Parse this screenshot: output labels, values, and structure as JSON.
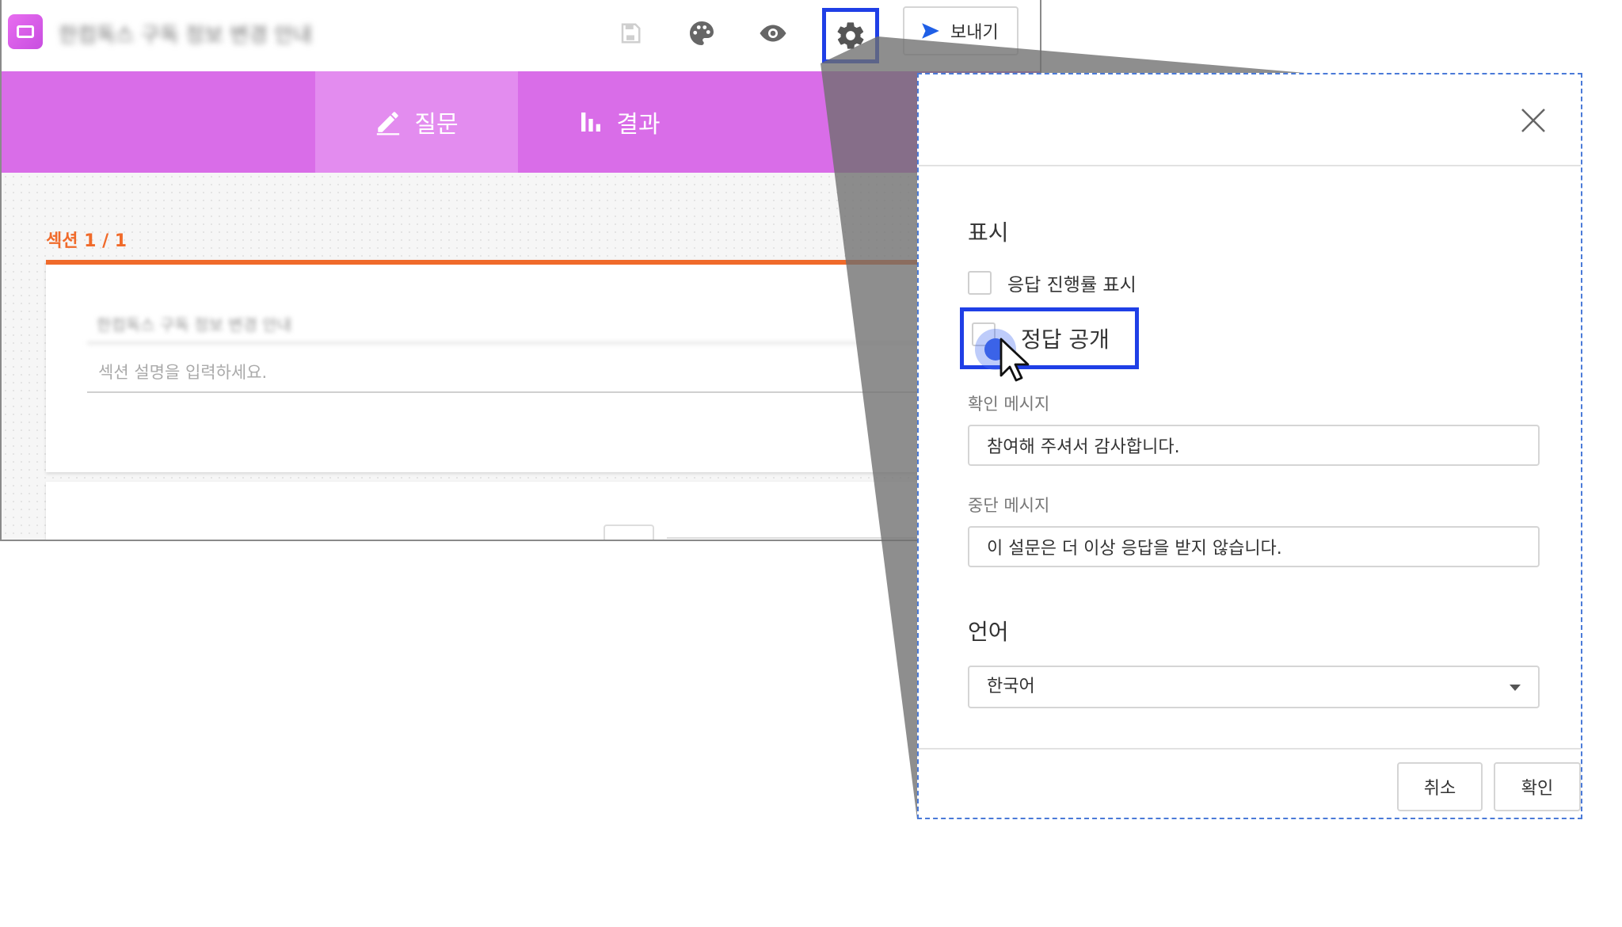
{
  "app": {
    "document_title": "한컴독스 구독 정보 변경 안내",
    "send_label": "보내기"
  },
  "toolbar": {
    "icons": [
      "save-icon",
      "palette-icon",
      "preview-eye-icon",
      "settings-gear-icon"
    ]
  },
  "tabs": [
    {
      "label": "질문",
      "icon": "pencil-icon",
      "active": true
    },
    {
      "label": "결과",
      "icon": "bar-chart-icon",
      "active": false
    }
  ],
  "section": {
    "label": "섹션 1 / 1",
    "title_value": "한컴독스 구독 정보 변경 안내",
    "description_placeholder": "섹션 설명을 입력하세요."
  },
  "dialog": {
    "display_heading": "표시",
    "show_progress_label": "응답 진행률 표시",
    "reveal_answers_label": "정답 공개",
    "confirm_message_label": "확인 메시지",
    "confirm_message_value": "참여해 주셔서 감사합니다.",
    "stop_message_label": "중단 메시지",
    "stop_message_value": "이 설문은 더 이상 응답을 받지 않습니다.",
    "language_heading": "언어",
    "language_value": "한국어",
    "cancel_label": "취소",
    "ok_label": "확인"
  },
  "colors": {
    "accent_purple": "#d96de8",
    "section_orange": "#f06a2a",
    "highlight_blue": "#1f3fe6"
  }
}
